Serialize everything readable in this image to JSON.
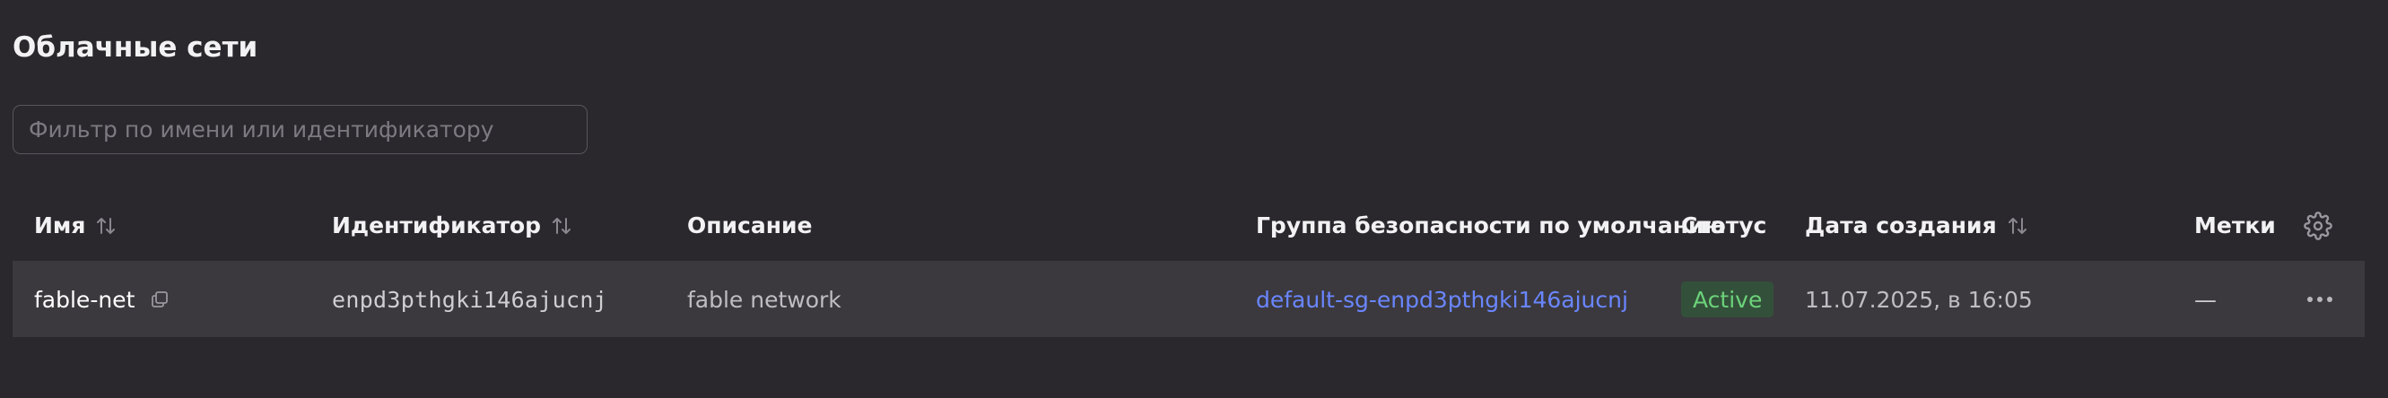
{
  "page": {
    "title": "Облачные сети"
  },
  "filter": {
    "placeholder": "Фильтр по имени или идентификатору",
    "value": ""
  },
  "table": {
    "columns": {
      "name": "Имя",
      "id": "Идентификатор",
      "description": "Описание",
      "security_group": "Группа безопасности по умолчанию",
      "status": "Статус",
      "created": "Дата создания",
      "labels": "Метки"
    },
    "rows": [
      {
        "name": "fable-net",
        "id": "enpd3pthgki146ajucnj",
        "description": "fable network",
        "security_group": "default-sg-enpd3pthgki146ajucnj",
        "status": "Active",
        "created": "11.07.2025, в 16:05",
        "labels": "—"
      }
    ]
  },
  "icons": {
    "sort": "sort-arrows-icon",
    "copy": "copy-icon",
    "more": "more-horizontal-icon",
    "settings": "gear-icon"
  },
  "colors": {
    "background": "#2a282d",
    "row": "#3b393e",
    "link": "#6a86ff",
    "status_active_bg": "#33513a",
    "status_active_text": "#6cd27a"
  }
}
